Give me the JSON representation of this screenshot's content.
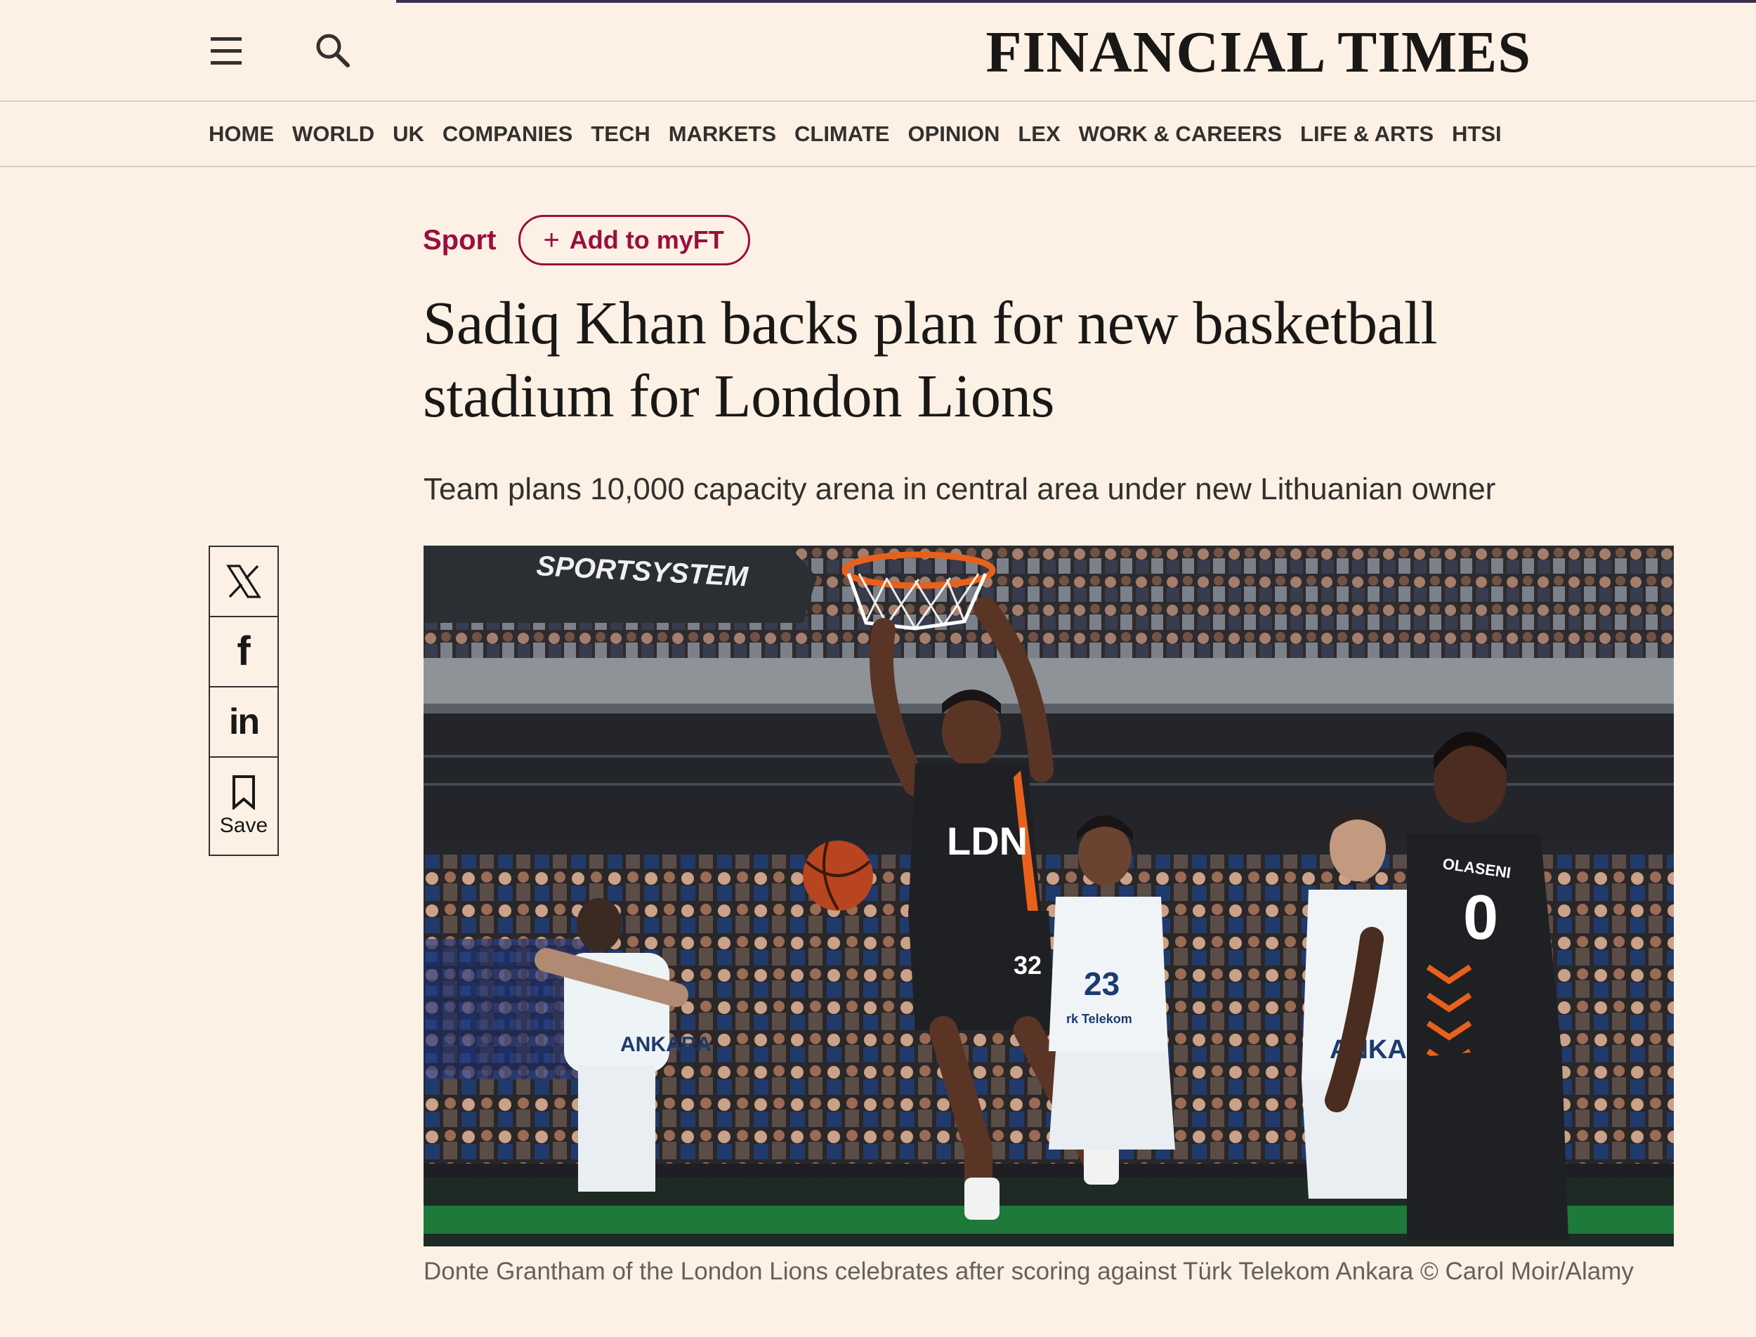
{
  "header": {
    "brand": "FINANCIAL TIMES",
    "menu_icon": "hamburger-menu-icon",
    "search_icon": "magnifier-search-icon"
  },
  "nav": {
    "items": [
      "HOME",
      "WORLD",
      "UK",
      "COMPANIES",
      "TECH",
      "MARKETS",
      "CLIMATE",
      "OPINION",
      "LEX",
      "WORK & CAREERS",
      "LIFE & ARTS",
      "HTSI"
    ]
  },
  "article": {
    "topic": "Sport",
    "myft_label": "Add to myFT",
    "headline": "Sadiq Khan backs plan for new basketball stadium for London Lions",
    "standfirst": "Team plans 10,000 capacity arena in central area under new Lithuanian owner",
    "caption": "Donte Grantham of the London Lions celebrates after scoring against Türk Telekom Ankara © Carol Moir/Alamy"
  },
  "share": {
    "save_label": "Save",
    "icons": [
      "x-twitter-icon",
      "facebook-icon",
      "linkedin-icon",
      "bookmark-icon"
    ]
  },
  "photo": {
    "board_text": "SPORTSYSTEM",
    "jersey_main": "32",
    "jersey_right": "0",
    "jersey_name_right": "OLASENI",
    "jersey_left": "ANKARA",
    "jersey_mid_number": "23",
    "jersey_mid_text": "rk Telekom",
    "jersey_far": "ANKA"
  },
  "colors": {
    "background": "#fdf1e5",
    "accent": "#990f3d",
    "text": "#33302e"
  }
}
